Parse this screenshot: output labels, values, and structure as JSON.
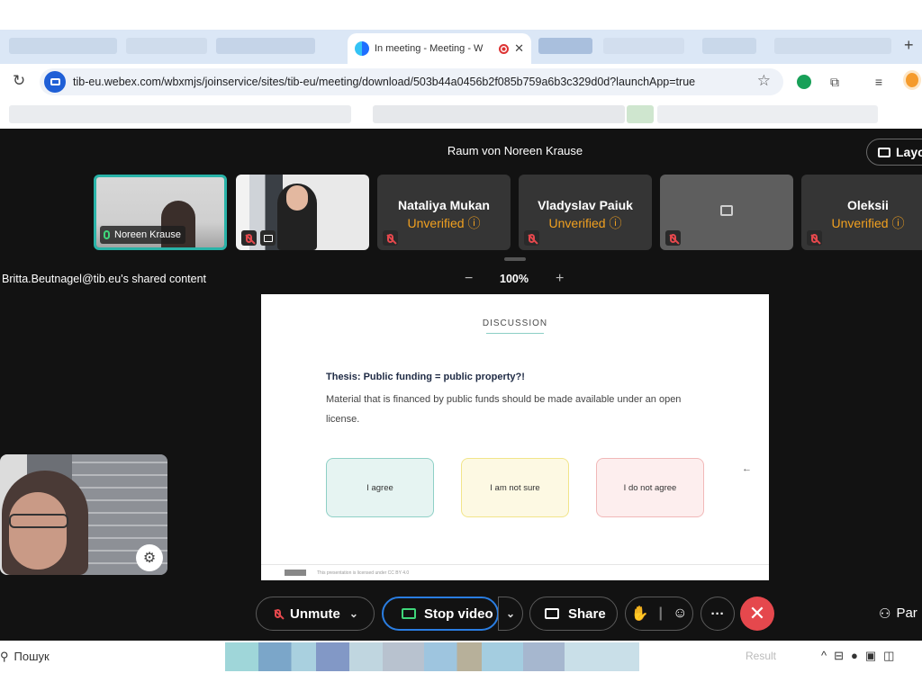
{
  "browser": {
    "active_tab_title": "In meeting - Meeting - W",
    "url": "tib-eu.webex.com/wbxmjs/joinservice/sites/tib-eu/meeting/download/503b44a0456b2f085b759a6b3c329d0d?launchApp=true",
    "new_tab": "+"
  },
  "meeting": {
    "room_title": "Raum von Noreen Krause",
    "layout_label": "Layo",
    "shared_content_label": "Britta.Beutnagel@tib.eu's shared content",
    "zoom": {
      "minus": "−",
      "value": "100%",
      "plus": "+"
    }
  },
  "participants": [
    {
      "name": "Noreen Krause",
      "mic": "on",
      "video": true
    },
    {
      "name": "",
      "mic": "off",
      "video": true
    },
    {
      "name": "Nataliya Mukan",
      "status": "Unverified ⓘ",
      "mic": "off",
      "video": false
    },
    {
      "name": "Vladyslav Paiuk",
      "status": "Unverified ⓘ",
      "mic": "off",
      "video": false
    },
    {
      "name": "",
      "mic": "off",
      "video": false
    },
    {
      "name": "Oleksii",
      "status": "Unverified ⓘ",
      "mic": "off",
      "video": false
    }
  ],
  "slide": {
    "heading": "DISCUSSION",
    "thesis": "Thesis: Public funding = public property?!",
    "description": "Material that is financed by public funds should be made available under an open license.",
    "options": [
      "I agree",
      "I am not sure",
      "I do not agree"
    ],
    "arrow": "←",
    "footer": "This presentation is licensed under CC BY 4.0"
  },
  "controls": {
    "unmute": "Unmute",
    "stop_video": "Stop video",
    "share": "Share",
    "more": "···",
    "end": "✕",
    "participants": "Par"
  },
  "taskbar": {
    "search": "Пошук",
    "weather": "Result",
    "tray_icons": [
      "chevron-up-icon",
      "network-icon",
      "microphone-icon",
      "app-icon",
      "speaker-icon"
    ]
  },
  "colors": {
    "meeting_bg": "#121212",
    "accent_teal": "#29b3a8",
    "unverified": "#f0a020",
    "end_call": "#e5484d",
    "video_active": "#2a7de1"
  }
}
